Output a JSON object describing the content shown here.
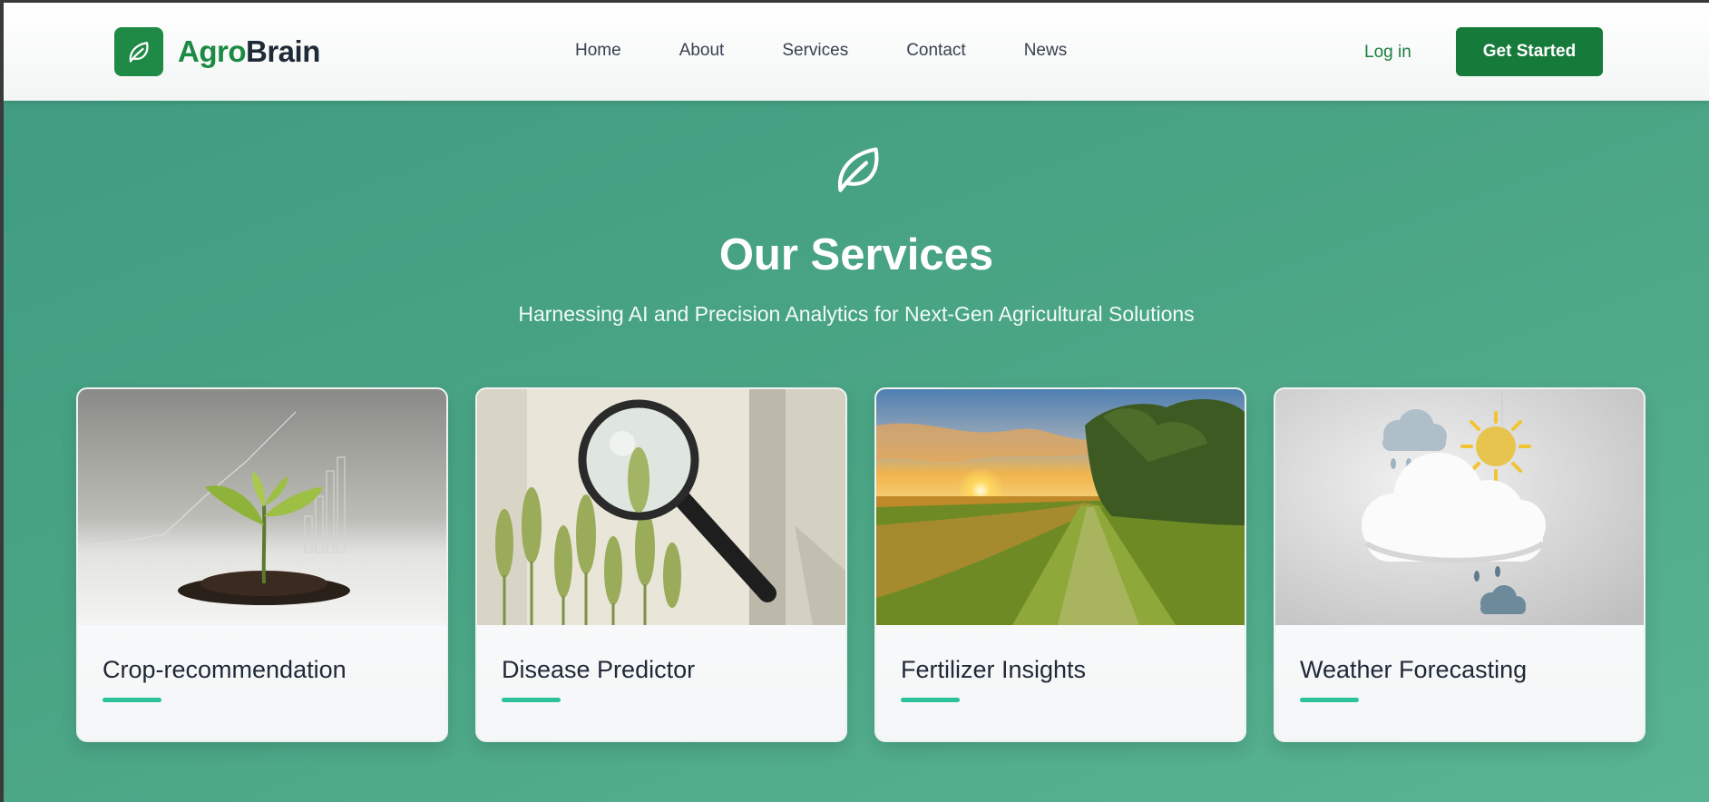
{
  "brand": {
    "name_part1": "Agro",
    "name_part2": "Brain",
    "logo_icon": "leaf-icon",
    "color": "#1f8a45"
  },
  "nav": {
    "items": [
      "Home",
      "About",
      "Services",
      "Contact",
      "News"
    ]
  },
  "auth": {
    "login_label": "Log in",
    "cta_label": "Get Started"
  },
  "hero": {
    "icon": "leaf-icon",
    "title": "Our Services",
    "subtitle": "Harnessing AI and Precision Analytics for Next-Gen Agricultural Solutions"
  },
  "services": [
    {
      "title": "Crop-recommendation",
      "image": "seedling-growth-chart-image"
    },
    {
      "title": "Disease Predictor",
      "image": "magnifier-wheat-image"
    },
    {
      "title": "Fertilizer Insights",
      "image": "sunset-field-path-image"
    },
    {
      "title": "Weather Forecasting",
      "image": "cloud-sun-rain-image"
    }
  ],
  "colors": {
    "accent": "#167a3b",
    "background": "#4aa585",
    "underline": "#2bc29a"
  }
}
